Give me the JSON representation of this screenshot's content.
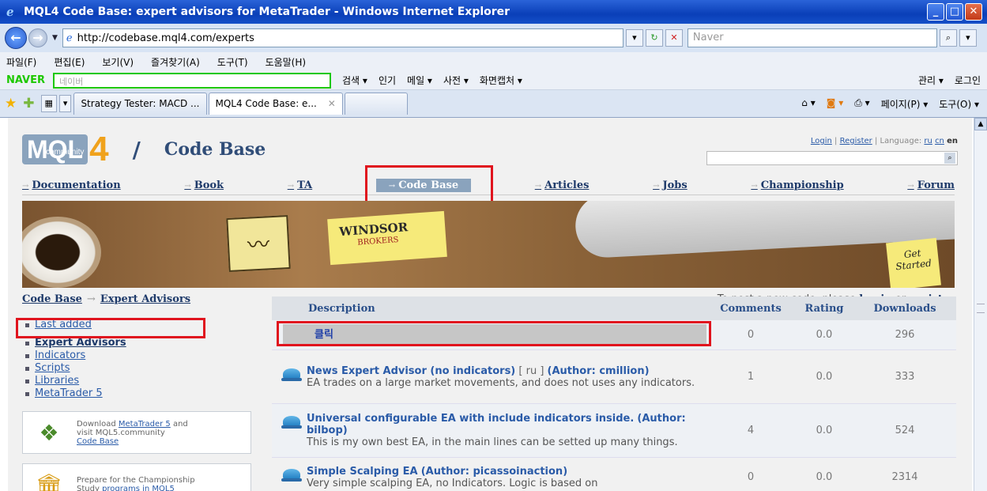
{
  "window": {
    "title": "MQL4 Code Base: expert advisors for MetaTrader - Windows Internet Explorer",
    "url": "http://codebase.mql4.com/experts",
    "search_placeholder": "Naver"
  },
  "menubar": [
    "파일(F)",
    "편집(E)",
    "보기(V)",
    "즐겨찾기(A)",
    "도구(T)",
    "도움말(H)"
  ],
  "naverbar": {
    "logo": "NAVER",
    "placeholder": "네이버",
    "items": [
      "검색 ▾",
      "인기",
      "메일 ▾",
      "사전 ▾",
      "화면캡처 ▾"
    ],
    "right": [
      "관리 ▾",
      "로그인"
    ]
  },
  "tabs": [
    "Strategy Tester: MACD ...",
    "MQL4 Code Base: e...",
    ""
  ],
  "commandbar": [
    "페이지(P) ▾",
    "도구(O) ▾"
  ],
  "site": {
    "logo_main": "MQL",
    "logo_sub": "community",
    "logo_num": "4",
    "slash": "/",
    "section_title": "Code Base",
    "login": "Login",
    "register": "Register",
    "language_label": "Language:",
    "langs": [
      "ru",
      "cn",
      "en"
    ],
    "menu": [
      "Documentation",
      "Book",
      "TA",
      "Code Base",
      "Articles",
      "Jobs",
      "Championship",
      "Forum"
    ],
    "banner": {
      "note_title": "WINDSOR",
      "note_sub": "BROKERS",
      "cta": "Get Started"
    },
    "breadcrumb": [
      "Code Base",
      "Expert Advisors"
    ],
    "post_note_prefix": "To post a new code, please",
    "post_login": "log in",
    "post_or": "or",
    "post_register": "register"
  },
  "sidebar": {
    "items": [
      "Last added",
      "Expert Advisors",
      "Indicators",
      "Scripts",
      "Libraries",
      "MetaTrader 5"
    ],
    "promo1": {
      "line1": "Download",
      "link1": "MetaTrader 5",
      "line2": "and visit MQL5.community",
      "link2": "Code Base"
    },
    "promo2": {
      "line1": "Prepare for the Championship",
      "line2": "Study",
      "link": "programs in MQL5"
    }
  },
  "table": {
    "headers": [
      "Description",
      "Comments",
      "Rating",
      "Downloads"
    ],
    "click_label": "클릭",
    "click_row": {
      "comments": "0",
      "rating": "0.0",
      "downloads": "296"
    },
    "rows": [
      {
        "title": "News Expert Advisor (no indicators)",
        "lang": " [ ru ] ",
        "author": "(Author: cmillion)",
        "desc": "EA trades on a large market movements, and does not uses any indicators.",
        "comments": "1",
        "rating": "0.0",
        "downloads": "333"
      },
      {
        "title": "Universal configurable EA with include indicators inside.",
        "lang": "",
        "author": "(Author: bilbop)",
        "desc": "This is my own best EA, in the main lines can be setted up many things.",
        "comments": "4",
        "rating": "0.0",
        "downloads": "524"
      },
      {
        "title": "Simple Scalping EA",
        "lang": "",
        "author": "(Author: picassoinaction)",
        "desc": "Very simple scalping EA, no Indicators. Logic is based on",
        "comments": "0",
        "rating": "0.0",
        "downloads": "2314"
      }
    ]
  },
  "colors": {
    "highlight": "#e0141e",
    "titlebar": "#0a3fb8",
    "link": "#2a5ba8"
  }
}
